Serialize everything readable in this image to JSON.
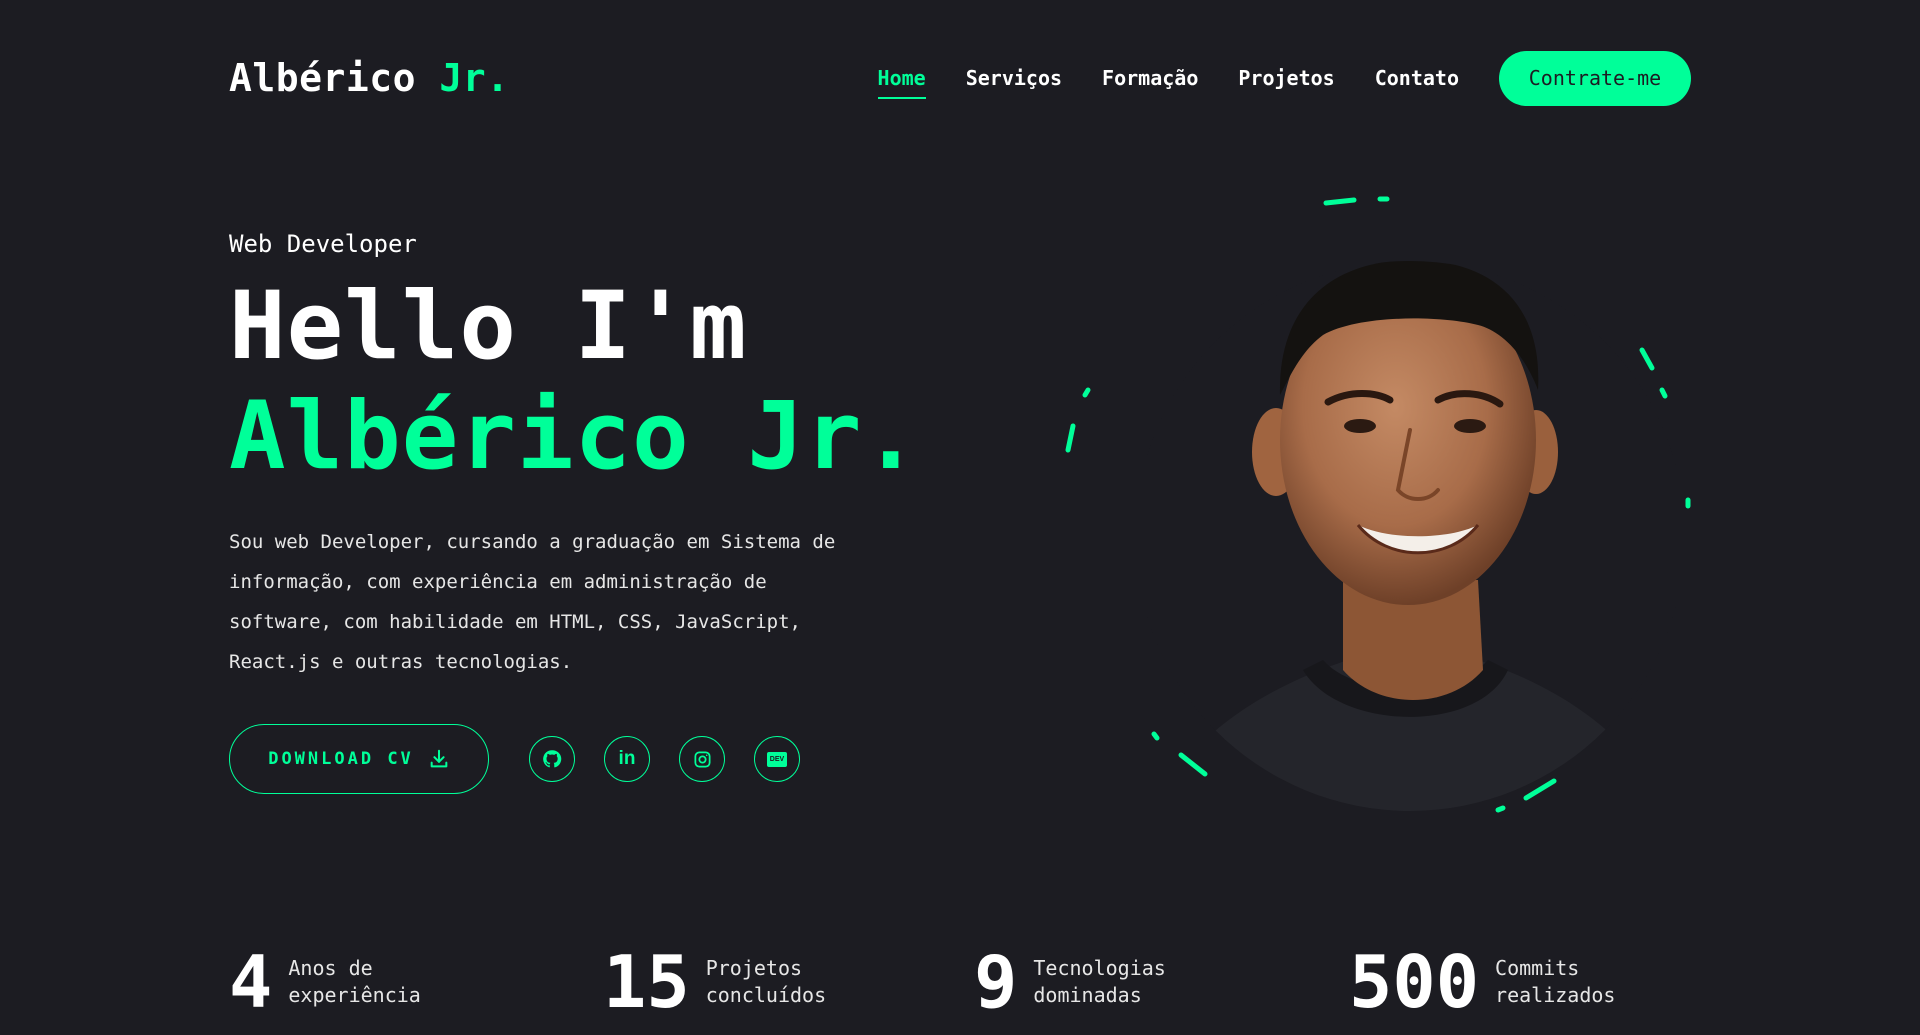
{
  "header": {
    "logo_main": "Albérico",
    "logo_accent": "Jr.",
    "nav": [
      {
        "label": "Home",
        "active": true
      },
      {
        "label": "Serviços"
      },
      {
        "label": "Formação"
      },
      {
        "label": "Projetos"
      },
      {
        "label": "Contato"
      }
    ],
    "hire_label": "Contrate-me"
  },
  "hero": {
    "role": "Web Developer",
    "greeting": "Hello I'm",
    "name": "Albérico Jr.",
    "description": "Sou web Developer, cursando a graduação em Sistema de informação, com experiência em administração de software, com habilidade em HTML, CSS, JavaScript, React.js e outras tecnologias.",
    "download_label": "DOWNLOAD CV",
    "social": [
      {
        "icon": "github-icon"
      },
      {
        "icon": "linkedin-icon",
        "text": "in"
      },
      {
        "icon": "instagram-icon"
      },
      {
        "icon": "dev-icon",
        "text": "DEV"
      }
    ]
  },
  "stats": [
    {
      "number": "4",
      "label": "Anos de experiência"
    },
    {
      "number": "15",
      "label": "Projetos concluídos"
    },
    {
      "number": "9",
      "label": "Tecnologias dominadas"
    },
    {
      "number": "500",
      "label": "Commits realizados"
    }
  ],
  "colors": {
    "background": "#1c1c22",
    "accent": "#00ff99",
    "text": "#ffffff"
  }
}
